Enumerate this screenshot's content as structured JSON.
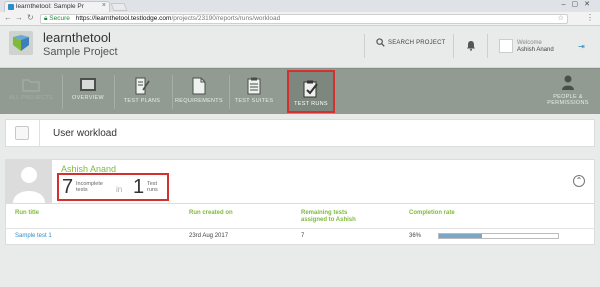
{
  "browser": {
    "tab_title": "learnthetool: Sample Pr",
    "secure_label": "Secure",
    "url_domain": "https://learnthetool.testlodge.com",
    "url_path": "/projects/23190/reports/runs/workload"
  },
  "header": {
    "brand_name": "learnthetool",
    "project_name": "Sample Project",
    "search_label": "SEARCH PROJECT",
    "welcome_label": "Welcome",
    "user_name": "Ashish Anand"
  },
  "modules": [
    {
      "label": "ALL PROJECTS"
    },
    {
      "label": "OVERVIEW"
    },
    {
      "label": "TEST PLANS"
    },
    {
      "label": "REQUIREMENTS"
    },
    {
      "label": "TEST SUITES"
    },
    {
      "label": "TEST RUNS"
    },
    {
      "label": "PEOPLE &"
    },
    {
      "label": "PERMISSIONS"
    }
  ],
  "page": {
    "title": "User workload"
  },
  "user": {
    "name": "Ashish Anand",
    "incomplete_count": "7",
    "incomplete_label_1": "Incomplete",
    "incomplete_label_2": "tests",
    "in_word": "in",
    "runs_count": "1",
    "runs_label_1": "Test",
    "runs_label_2": "runs"
  },
  "table": {
    "headers": {
      "run_title": "Run title",
      "run_created": "Run created on",
      "remaining_1": "Remaining tests",
      "remaining_2": "assigned to Ashish",
      "completion": "Completion rate"
    },
    "rows": [
      {
        "title": "Sample test 1",
        "created": "23rd Aug 2017",
        "remaining": "7",
        "rate": "36%",
        "rate_value": 0.36
      }
    ]
  },
  "colors": {
    "accent_green": "#7fba3a",
    "link_blue": "#2c8dc8",
    "highlight_red": "#d43030",
    "nav_bg": "#929b92"
  }
}
